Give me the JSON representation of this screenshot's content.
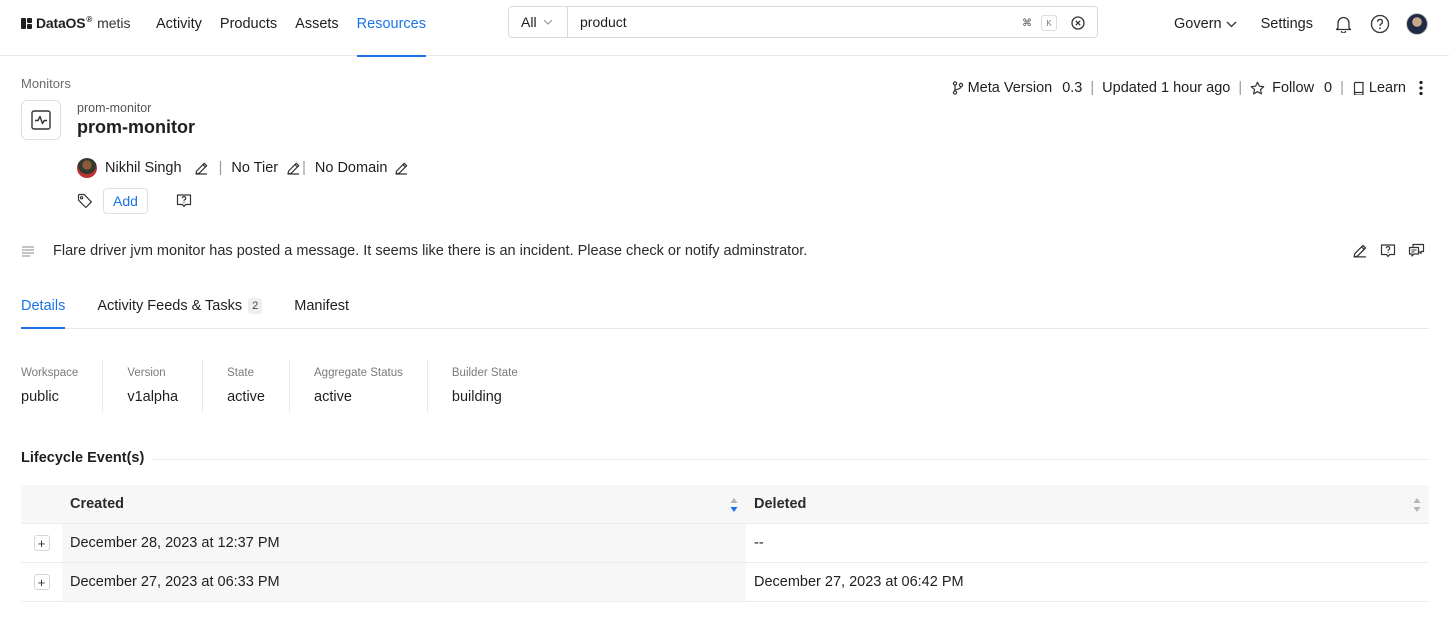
{
  "brand": {
    "name": "DataOS",
    "reg": "®",
    "sub": "metis"
  },
  "nav": {
    "links": [
      "Activity",
      "Products",
      "Assets",
      "Resources"
    ],
    "active": "Resources"
  },
  "search": {
    "scope": "All",
    "value": "product",
    "kbd_cmd": "⌘",
    "kbd_key": "K"
  },
  "topright": {
    "govern": "Govern",
    "settings": "Settings"
  },
  "breadcrumb": "Monitors",
  "entity": {
    "subtitle": "prom-monitor",
    "title": "prom-monitor"
  },
  "meta": {
    "version_label": "Meta Version",
    "version_value": "0.3",
    "updated": "Updated 1 hour ago",
    "follow_label": "Follow",
    "follow_count": "0",
    "learn_label": "Learn"
  },
  "owner": {
    "name": "Nikhil Singh",
    "tier": "No Tier",
    "domain": "No Domain"
  },
  "tags": {
    "add_label": "Add"
  },
  "description": "Flare driver jvm monitor has posted a message. It seems like there is an incident. Please check or notify adminstrator.",
  "tabs": [
    {
      "label": "Details",
      "active": true
    },
    {
      "label": "Activity Feeds & Tasks",
      "count": "2"
    },
    {
      "label": "Manifest"
    }
  ],
  "properties": [
    {
      "label": "Workspace",
      "value": "public"
    },
    {
      "label": "Version",
      "value": "v1alpha"
    },
    {
      "label": "State",
      "value": "active"
    },
    {
      "label": "Aggregate Status",
      "value": "active"
    },
    {
      "label": "Builder State",
      "value": "building"
    }
  ],
  "lifecycle": {
    "title": "Lifecycle Event(s)",
    "columns": [
      "Created",
      "Deleted"
    ],
    "rows": [
      {
        "created": "December 28, 2023 at 12:37 PM",
        "deleted": "--"
      },
      {
        "created": "December 27, 2023 at 06:33 PM",
        "deleted": "December 27, 2023 at 06:42 PM"
      }
    ]
  },
  "colors": {
    "accent": "#1a73e8",
    "text": "#1f1f1f",
    "muted": "#7a7a7a",
    "border": "#e8e8e8"
  }
}
